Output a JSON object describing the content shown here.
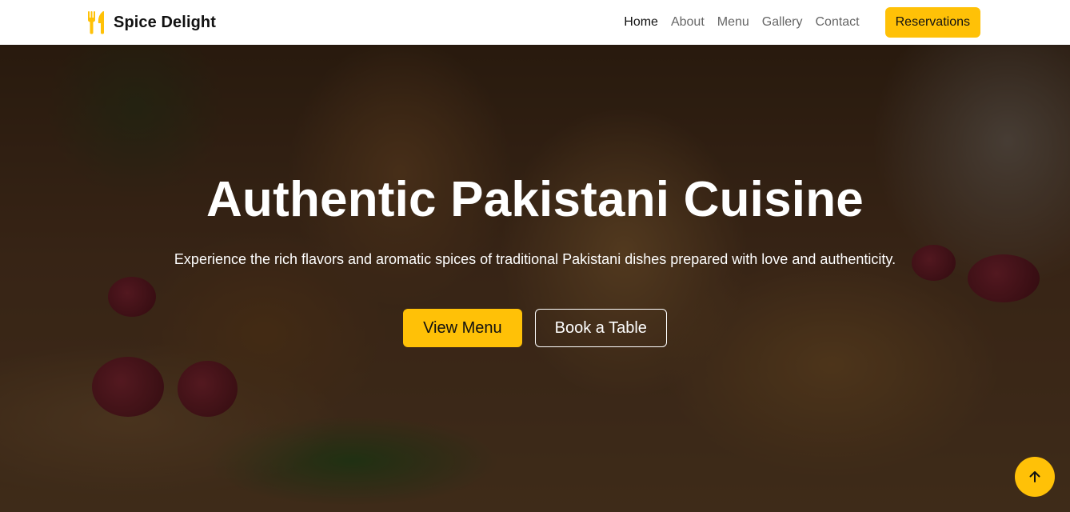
{
  "brand": {
    "name": "Spice Delight",
    "icon": "utensils-icon",
    "color": "#ffc107"
  },
  "nav": {
    "links": [
      {
        "label": "Home",
        "active": true
      },
      {
        "label": "About",
        "active": false
      },
      {
        "label": "Menu",
        "active": false
      },
      {
        "label": "Gallery",
        "active": false
      },
      {
        "label": "Contact",
        "active": false
      }
    ],
    "cta_label": "Reservations"
  },
  "hero": {
    "title": "Authentic Pakistani Cuisine",
    "subtitle": "Experience the rich flavors and aromatic spices of traditional Pakistani dishes prepared with love and authenticity.",
    "primary_button": "View Menu",
    "secondary_button": "Book a Table"
  },
  "back_to_top": {
    "icon": "arrow-up-icon"
  },
  "colors": {
    "accent": "#ffc107",
    "nav_bg": "#ffffff",
    "text_dark": "#111111"
  }
}
